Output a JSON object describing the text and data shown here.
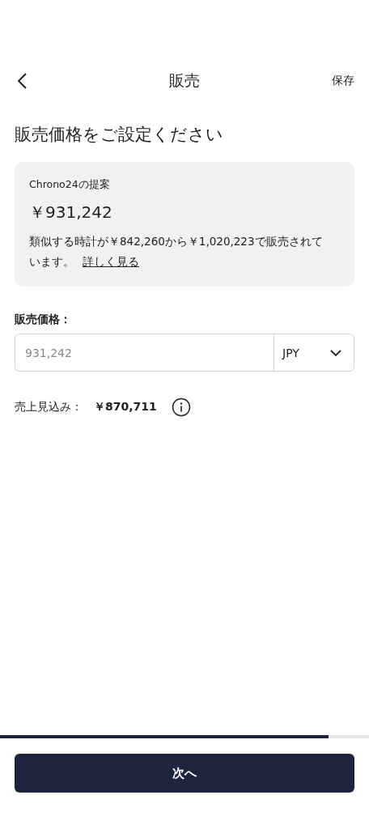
{
  "header": {
    "title": "販売",
    "action": "保存"
  },
  "heading": "販売価格をご設定ください",
  "suggestion": {
    "title": "Chrono24の提案",
    "price": "￥931,242",
    "text": "類似する時計が￥842,260から￥1,020,223で販売されています。",
    "link": "詳しく見る"
  },
  "price_field": {
    "label": "販売価格：",
    "placeholder": "931,242",
    "currency": "JPY"
  },
  "earnings": {
    "label": "売上見込み：",
    "value": "￥870,711"
  },
  "progress": {
    "level": 0.89
  },
  "next_button": "次へ"
}
